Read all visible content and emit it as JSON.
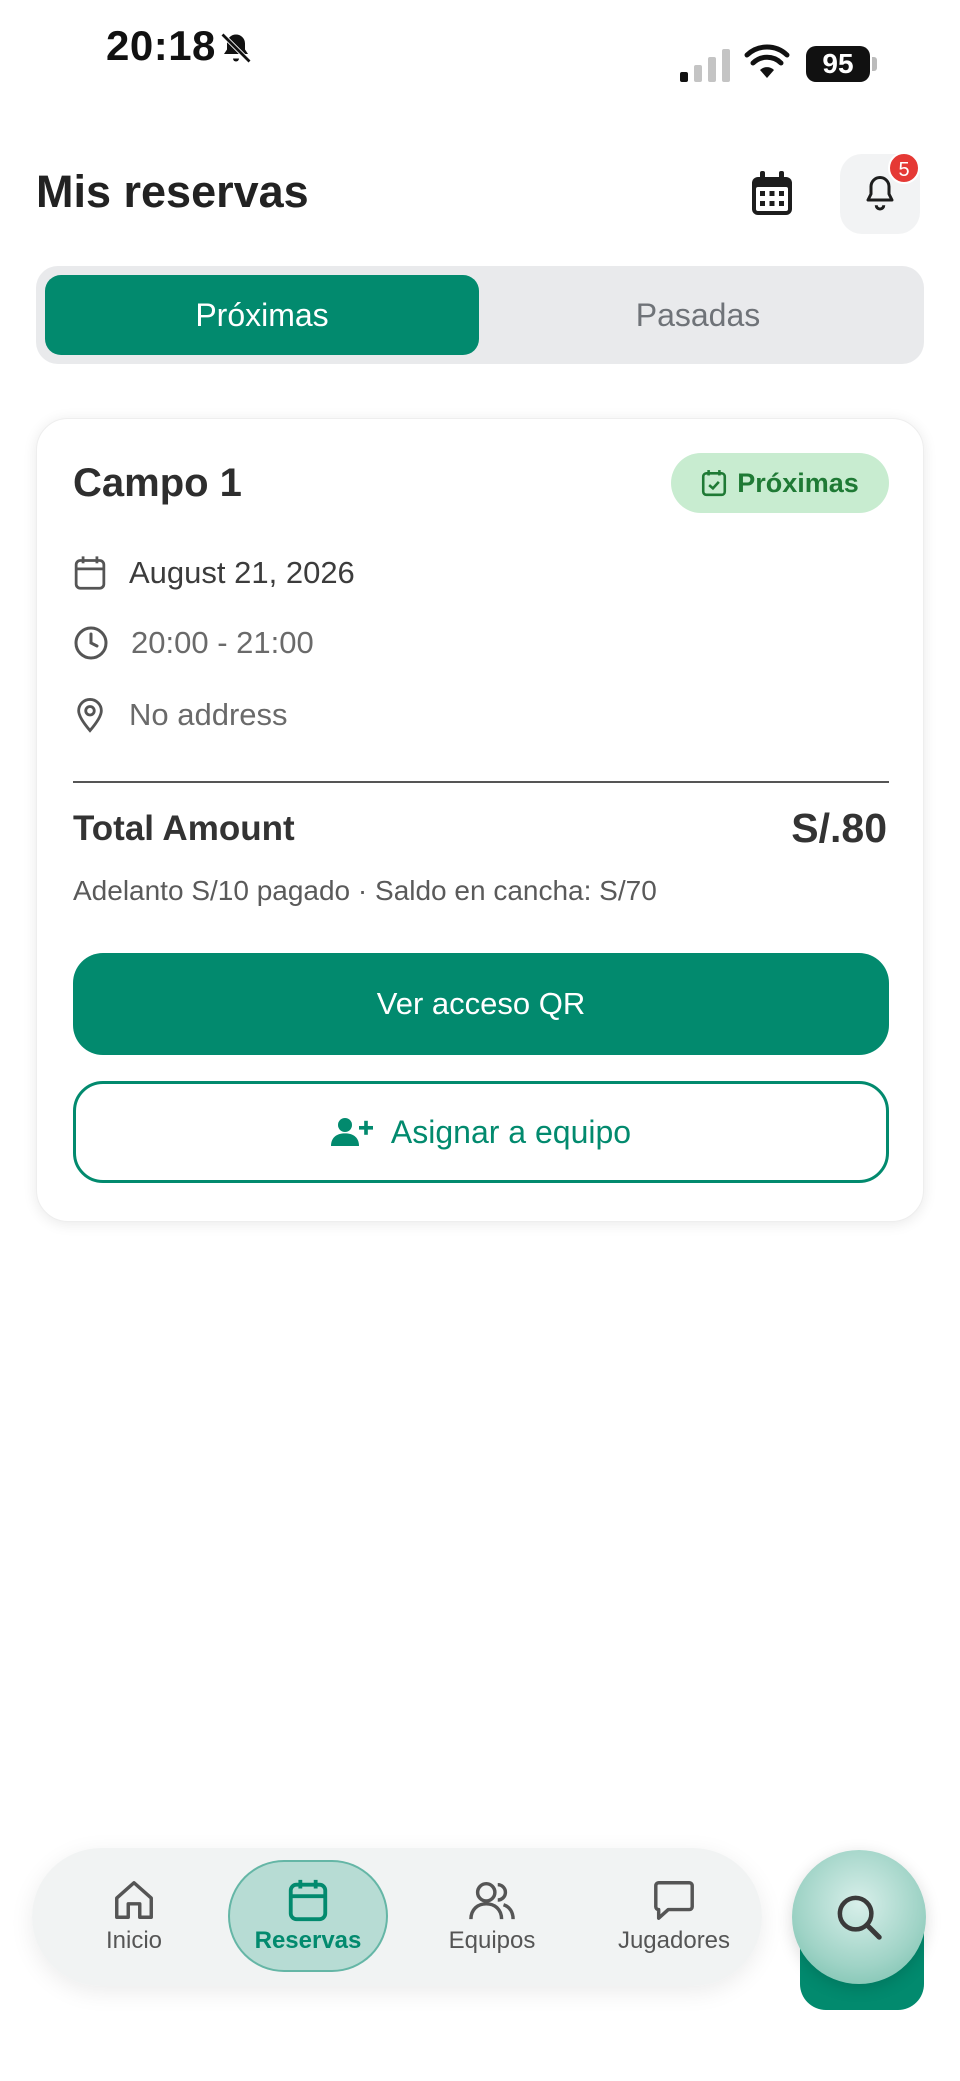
{
  "status_bar": {
    "time": "20:18",
    "battery": "95"
  },
  "header": {
    "title": "Mis reservas",
    "notification_count": "5"
  },
  "tabs": [
    {
      "label": "Próximas",
      "active": true
    },
    {
      "label": "Pasadas",
      "active": false
    }
  ],
  "booking": {
    "field_name": "Campo 1",
    "status": "Próximas",
    "date": "August 21, 2026",
    "time": "20:00 - 21:00",
    "address": "No address",
    "total_label": "Total Amount",
    "total_value": "S/.80",
    "payment_note": "Adelanto S/10 pagado · Saldo en cancha: S/70",
    "qr_button": "Ver acceso QR",
    "assign_button": "Asignar a equipo"
  },
  "nav": {
    "items": [
      {
        "label": "Inicio",
        "icon": "home-icon"
      },
      {
        "label": "Reservas",
        "icon": "calendar-icon",
        "active": true
      },
      {
        "label": "Equipos",
        "icon": "users-icon"
      },
      {
        "label": "Jugadores",
        "icon": "chat-icon"
      }
    ],
    "search_icon": "search-icon"
  },
  "colors": {
    "primary": "#028a6e",
    "badge_bg": "#c8ecd0",
    "badge_text": "#1f7a35",
    "alert": "#e53935"
  }
}
